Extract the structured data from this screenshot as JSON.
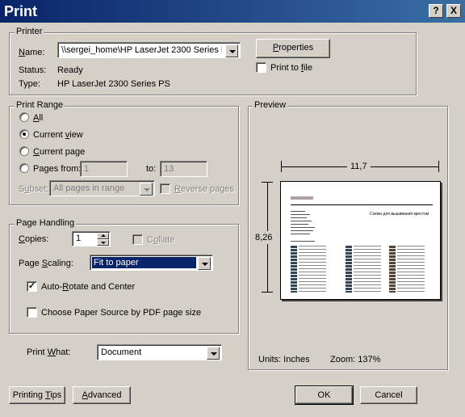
{
  "window": {
    "title": "Print",
    "help_label": "?",
    "close_label": "X"
  },
  "printer": {
    "group_label": "Printer",
    "name_label": "Name:",
    "name_value": "\\\\sergei_home\\HP LaserJet 2300 Series PS",
    "status_label": "Status:",
    "status_value": "Ready",
    "type_label": "Type:",
    "type_value": "HP LaserJet 2300 Series PS",
    "properties_button": "Properties",
    "print_to_file_label": "Print to file",
    "print_to_file_checked": false
  },
  "print_range": {
    "group_label": "Print Range",
    "options": [
      {
        "label": "All",
        "checked": false
      },
      {
        "label": "Current view",
        "checked": true
      },
      {
        "label": "Current page",
        "checked": false
      },
      {
        "label": "Pages from:",
        "checked": false
      }
    ],
    "from_value": "1",
    "to_label": "to:",
    "to_value": "13",
    "subset_label": "Subset:",
    "subset_value": "All pages in range",
    "reverse_pages_label": "Reverse pages"
  },
  "page_handling": {
    "group_label": "Page Handling",
    "copies_label": "Copies:",
    "copies_value": "1",
    "collate_label": "Collate",
    "scaling_label": "Page Scaling:",
    "scaling_value": "Fit to paper",
    "auto_rotate_label": "Auto-Rotate and Center",
    "auto_rotate_checked": true,
    "choose_paper_label": "Choose Paper Source by PDF page size",
    "choose_paper_checked": false
  },
  "print_what": {
    "label": "Print What:",
    "value": "Document"
  },
  "preview": {
    "group_label": "Preview",
    "width_value": "11,7",
    "height_value": "8,26",
    "units_text": "Units: Inches",
    "zoom_text": "Zoom: 137%",
    "page_heading": "Схема для вышивания крестом"
  },
  "buttons": {
    "printing_tips": "Printing Tips",
    "advanced": "Advanced",
    "ok": "OK",
    "cancel": "Cancel"
  },
  "colors": {
    "titlebar_start": "#0a246a",
    "titlebar_end": "#3a6ea5",
    "dialog_bg": "#d4d0c8",
    "selection": "#0a246a"
  }
}
